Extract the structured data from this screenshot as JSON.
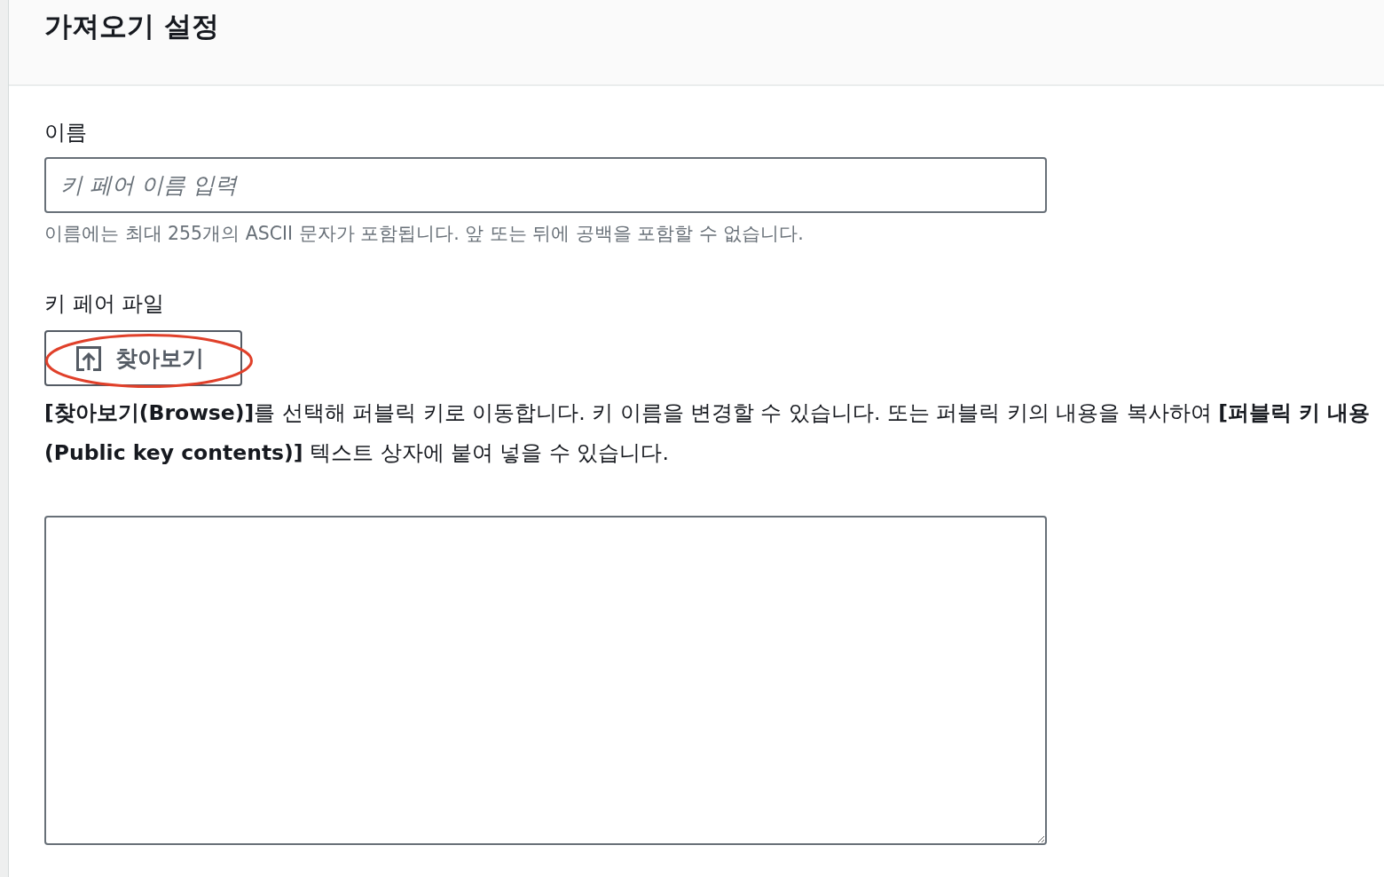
{
  "header": {
    "title": "가져오기 설정"
  },
  "name_field": {
    "label": "이름",
    "placeholder": "키 페어 이름 입력",
    "hint": "이름에는 최대 255개의 ASCII 문자가 포함됩니다. 앞 또는 뒤에 공백을 포함할 수 없습니다."
  },
  "key_file": {
    "label": "키 페어 파일",
    "browse_button": {
      "label": "찾아보기",
      "circled": true
    },
    "description": "**[찾아보기(Browse)]**를 선택해 퍼블릭 키로 이동합니다. 키 이름을 변경할 수 있습니다. 또는 퍼블릭 키의 내용을 복사하여 **[퍼블릭 키 내용 (Public key contents)]** 텍스트 상자에 붙여 넣을 수 있습니다."
  }
}
